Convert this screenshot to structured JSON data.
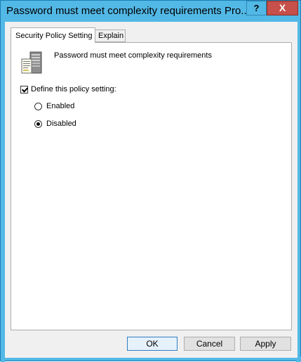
{
  "window": {
    "title": "Password must meet complexity requirements Pro...",
    "help_label": "?",
    "close_label": "X"
  },
  "tabs": [
    {
      "label": "Security Policy Setting",
      "active": true
    },
    {
      "label": "Explain",
      "active": false
    }
  ],
  "policy": {
    "icon": "server-policy-icon",
    "title": "Password must meet complexity requirements"
  },
  "define_setting": {
    "label": "Define this policy setting:",
    "checked": true
  },
  "options": [
    {
      "label": "Enabled",
      "selected": false
    },
    {
      "label": "Disabled",
      "selected": true
    }
  ],
  "buttons": {
    "ok": "OK",
    "cancel": "Cancel",
    "apply": "Apply"
  },
  "colors": {
    "frame": "#52b8e6",
    "close": "#c7504a",
    "default_button_border": "#2f7ec2"
  }
}
